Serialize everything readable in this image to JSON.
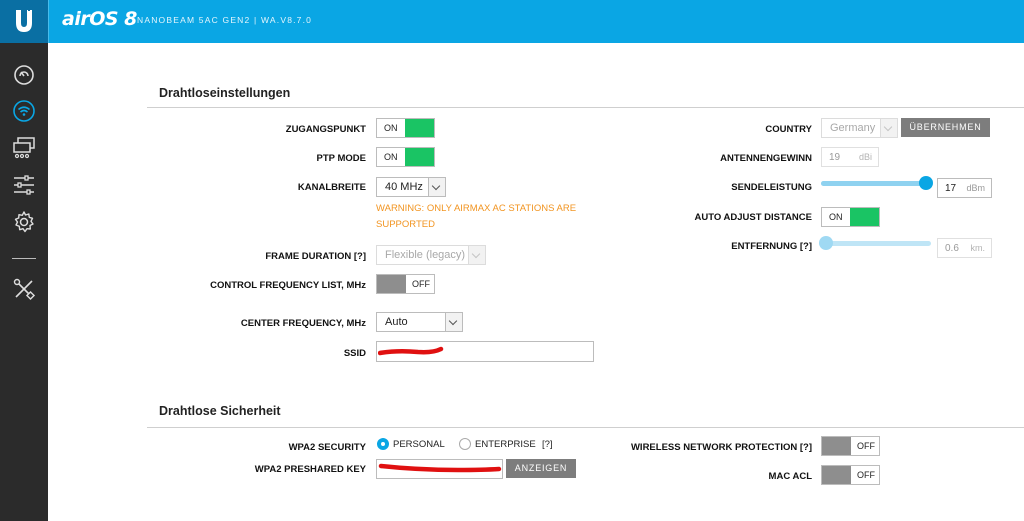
{
  "header": {
    "brand": "airOS 8",
    "device_info": "NANOBEAM 5AC GEN2 | WA.V8.7.0",
    "logo_icon": "ubiquiti-u-icon",
    "bar_color": "#0aa6e4"
  },
  "sidebar": {
    "items": [
      {
        "icon": "dashboard-icon"
      },
      {
        "icon": "wireless-icon",
        "active": true
      },
      {
        "icon": "network-icon"
      },
      {
        "icon": "services-icon"
      },
      {
        "icon": "settings-gear-icon"
      },
      {
        "icon": "tools-icon"
      }
    ]
  },
  "wireless": {
    "title": "Drahtloseinstellungen",
    "access_point": {
      "label": "ZUGANGSPUNKT",
      "state": "ON"
    },
    "ptp_mode": {
      "label": "PTP MODE",
      "state": "ON"
    },
    "channel_width": {
      "label": "KANALBREITE",
      "value": "40 MHz"
    },
    "warning": "WARNING: ONLY AIRMAX AC STATIONS ARE SUPPORTED",
    "frame_duration": {
      "label": "FRAME DURATION",
      "help": "[?]",
      "value": "Flexible (legacy)"
    },
    "control_freq": {
      "label": "CONTROL FREQUENCY LIST, MHz",
      "state": "OFF"
    },
    "center_freq": {
      "label": "CENTER FREQUENCY, MHz",
      "value": "Auto"
    },
    "ssid": {
      "label": "SSID",
      "value": ""
    },
    "country": {
      "label": "COUNTRY",
      "value": "Germany",
      "apply_label": "ÜBERNEHMEN"
    },
    "antenna_gain": {
      "label": "ANTENNENGEWINN",
      "value": "19",
      "unit": "dBi"
    },
    "tx_power": {
      "label": "SENDELEISTUNG",
      "value": "17",
      "unit": "dBm",
      "level": 1.0
    },
    "auto_adjust": {
      "label": "AUTO ADJUST DISTANCE",
      "state": "ON"
    },
    "distance": {
      "label": "ENTFERNUNG",
      "help": "[?]",
      "value": "0.6",
      "unit": "km.",
      "level": 0.0
    }
  },
  "security": {
    "title": "Drahtlose Sicherheit",
    "wpa2": {
      "label": "WPA2 SECURITY",
      "options": [
        "PERSONAL",
        "ENTERPRISE"
      ],
      "selected": "PERSONAL",
      "help": "[?]"
    },
    "psk": {
      "label": "WPA2 PRESHARED KEY",
      "value": "",
      "show_label": "ANZEIGEN"
    },
    "wnp": {
      "label": "WIRELESS NETWORK PROTECTION",
      "help": "[?]",
      "state": "OFF"
    },
    "mac_acl": {
      "label": "MAC ACL",
      "state": "OFF"
    }
  }
}
